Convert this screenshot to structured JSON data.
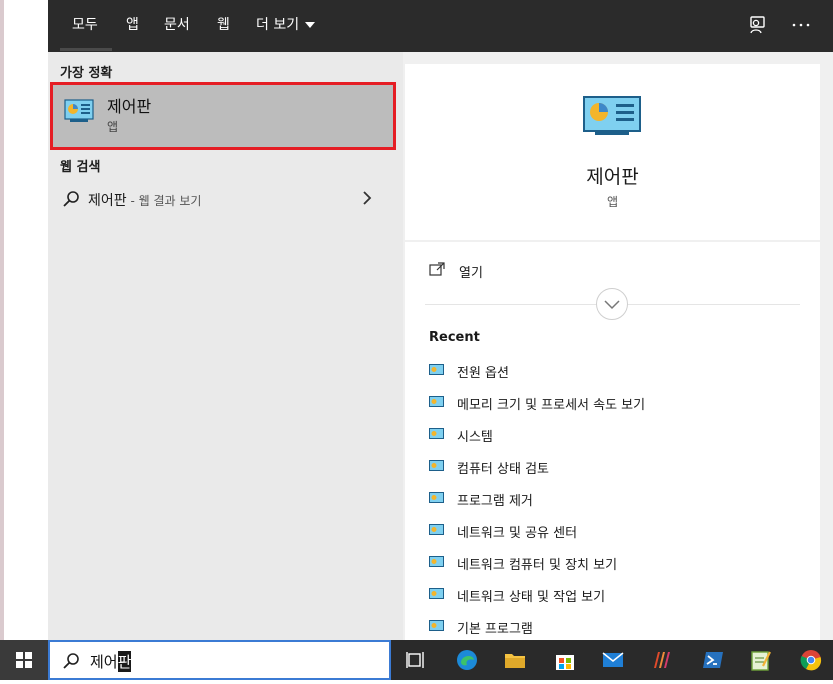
{
  "tabs": [
    {
      "label": "모두"
    },
    {
      "label": "앱"
    },
    {
      "label": "문서"
    },
    {
      "label": "웹"
    },
    {
      "label": "더 보기"
    }
  ],
  "left": {
    "best_match_label": "가장 정확",
    "best_match": {
      "title": "제어판",
      "subtitle": "앱"
    },
    "web_search_label": "웹 검색",
    "web_result": {
      "query": "제어판",
      "suffix": " - 웹 결과 보기"
    }
  },
  "detail": {
    "title": "제어판",
    "subtitle": "앱",
    "open_label": "열기",
    "recent_label": "Recent",
    "recent_items": [
      "전원 옵션",
      "메모리 크기 및 프로세서 속도 보기",
      "시스템",
      "컴퓨터 상태 검토",
      "프로그램 제거",
      "네트워크 및 공유 센터",
      "네트워크 컴퓨터 및 장치 보기",
      "네트워크 상태 및 작업 보기",
      "기본 프로그램"
    ]
  },
  "search": {
    "typed": "제어",
    "selected": "판"
  },
  "colors": {
    "highlight_border": "#e51d24",
    "topbar": "#2b2b2b",
    "taskbar": "#2a2a2a"
  },
  "taskbar_icons": [
    "task-view-icon",
    "edge-icon",
    "file-explorer-icon",
    "store-icon",
    "mail-icon",
    "app-icon",
    "powershell-icon",
    "notepad-icon",
    "chrome-icon"
  ]
}
